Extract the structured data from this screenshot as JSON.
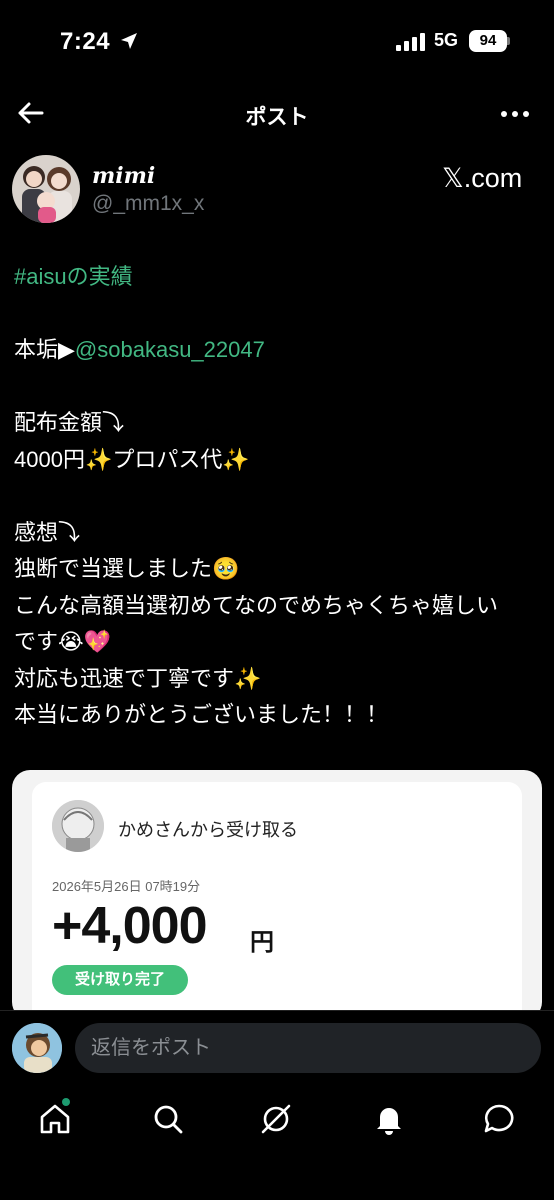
{
  "status_bar": {
    "time": "7:24",
    "network": "5G",
    "battery": "94"
  },
  "header": {
    "title": "ポスト"
  },
  "author": {
    "display_name": "mimi",
    "handle": "@_mm1x_x",
    "source": "𝕏.com"
  },
  "post": {
    "hashtag": "#aisuの実績",
    "line_main_prefix": "本垢▶︎",
    "mention": "@sobakasu_22047",
    "line_amount_label": "配布金額⤵︎",
    "line_amount": "4000円✨プロパス代✨",
    "line_thoughts_label": "感想⤵︎",
    "line_1": "独断で当選しました🥹",
    "line_2": "こんな高額当選初めてなのでめちゃくちゃ嬉しい",
    "line_3": "です😭💖",
    "line_4": "対応も迅速で丁寧です✨",
    "line_5": "本当にありがとうございました！！！"
  },
  "card": {
    "sender_text": "かめさんから受け取る",
    "date": "2026年5月26日 07時19分",
    "amount": "+4,000",
    "unit": "円",
    "status": "受け取り完了"
  },
  "reply": {
    "placeholder": "返信をポスト"
  },
  "nav": {
    "items": [
      "home-icon",
      "search-icon",
      "grok-icon",
      "notifications-icon",
      "messages-icon"
    ]
  },
  "colors": {
    "accent": "#42b883",
    "background": "#000000",
    "badge": "#42c07a"
  }
}
